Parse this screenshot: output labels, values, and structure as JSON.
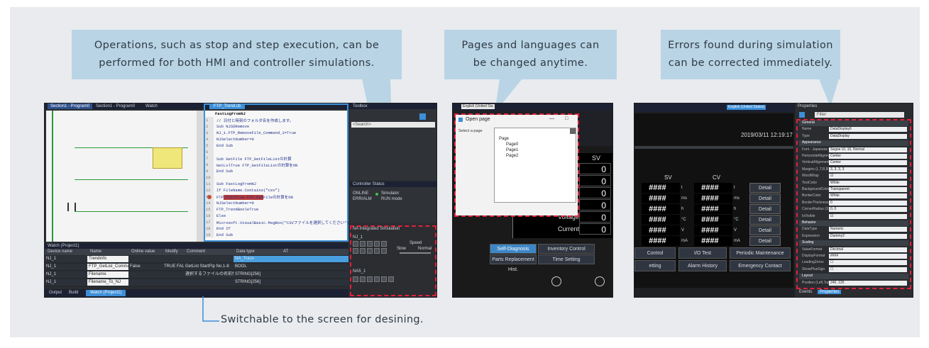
{
  "callouts": {
    "left": {
      "line1": "Operations, such as stop and step execution, can be",
      "line2": "performed for both HMI and controller simulations."
    },
    "middle": {
      "line1": "Pages and languages can",
      "line2": "be changed anytime."
    },
    "right": {
      "line1": "Errors found during simulation",
      "line2": "can be corrected immediately."
    }
  },
  "caption": "Switchable to the screen for desining.",
  "colors": {
    "callout_bg": "#b9d4e5",
    "highlight": "#e0213b",
    "switch_frame": "#3d8fd8"
  },
  "left_screen": {
    "tabs": [
      "Section1 - Program0",
      "Section1 - Program0",
      "Watch"
    ],
    "code_tab": "FTP_Trend.cb",
    "code_title": "FastLogFromNJ",
    "code_lines": [
      "// 日付と時刻のフォルダ名を作成します。",
      "Sub NJSDRemove",
      "  NJ_1.FTP_RemoveFile_Command_1=True",
      "  NJSelectNumber=0",
      "End Sub",
      "",
      "Sub GetFile         FTP_GetFileListの計算",
      "  GetLvlTrue        FTP_GetFileListの計算をON",
      "End Sub",
      "",
      "Sub FastLogFromNJ",
      "  If FileName.Contains(\"csv\")",
      "  FTP_PutsTrue      FTP_PutFileの計算をON",
      "  NJSelectNumber=0",
      "  FTP_TrendBooleTrue",
      "  Else",
      "  Microsoft.VisualBasic.MsgBox(\"CSVファイルを選択してください\")",
      "  End If",
      "End Sub"
    ],
    "toolbox_title": "Toolbox",
    "toolbox_search": "<Search>",
    "controller_status_title": "Controller Status",
    "controller_status_rows": [
      [
        "ONLINE",
        "Simulator"
      ],
      [
        "ERR/ALM",
        "RUN mode"
      ]
    ],
    "sim_panel_title": "NA Integrated Simulation",
    "sim_labels": {
      "nj": "NJ_1",
      "speed": "Speed",
      "slow": "Slow",
      "normal": "Normal",
      "na": "NA5_1"
    },
    "watch_title": "Watch (Project1)",
    "watch_headers": [
      "Device name",
      "Name",
      "Online value",
      "Modify",
      "Comment",
      "Data type",
      "AT"
    ],
    "watch_rows": [
      [
        "NJ_1",
        "Trendinfo",
        "",
        "",
        "",
        "NA_Trace",
        ""
      ],
      [
        "NJ_1",
        "FTP_GetList_Command_1",
        "False",
        "TRUE FALSE",
        "GetList StartFtp No.1-8",
        "BOOL",
        ""
      ],
      [
        "NJ_1",
        "Filename",
        "",
        "",
        "選択するファイルの名前情報",
        "STRING[256]",
        ""
      ],
      [
        "NJ_1",
        "Filename_To_NJ",
        "",
        "",
        "",
        "STRING[256]",
        ""
      ]
    ],
    "bottom_tabs": [
      "Output",
      "Build",
      "Watch (Project1)"
    ]
  },
  "middle_screen": {
    "language_dropdown": "English (United Sta",
    "dialog_title": "Open page",
    "minimize_glyph": "—",
    "maximize_glyph": "□",
    "select_label": "Select a page",
    "tree_root": "Page",
    "tree_items": [
      "Page0",
      "Page1",
      "Page2"
    ],
    "hmi_partial_header": "SV",
    "values": [
      "0",
      "0",
      "0",
      "0",
      "0",
      "0"
    ],
    "row_labels": [
      "Voltage",
      "Current"
    ],
    "buttons_row1": [
      "Self-Diagnosis",
      "Inventory Control"
    ],
    "buttons_row2": [
      "Parts Replacement Hist.",
      "Time Setting"
    ]
  },
  "right_screen": {
    "language_dropdown": "English (United States)",
    "timestamp": "2019/03/11 12:19:17",
    "col_headers": [
      "SV",
      "CV"
    ],
    "rows": [
      {
        "sv": "####",
        "unit_sv": "t",
        "cv": "####",
        "unit_cv": "t",
        "action": "Detail"
      },
      {
        "sv": "####",
        "unit_sv": "ms",
        "cv": "####",
        "unit_cv": "ms",
        "action": "Detail"
      },
      {
        "sv": "####",
        "unit_sv": "h",
        "cv": "####",
        "unit_cv": "h",
        "action": "Detail"
      },
      {
        "sv": "####",
        "unit_sv": "°C",
        "cv": "####",
        "unit_cv": "°C",
        "action": "Detail"
      },
      {
        "sv": "####",
        "unit_sv": "V",
        "cv": "####",
        "unit_cv": "V",
        "action": "Detail"
      },
      {
        "sv": "####",
        "unit_sv": "mA",
        "cv": "####",
        "unit_cv": "mA",
        "action": "Detail"
      }
    ],
    "buttons_row1": [
      "Control",
      "I/O Test",
      "Periodic Maintenance"
    ],
    "buttons_row2": [
      "etting",
      "Alarm History",
      "Emergency Contact"
    ],
    "properties_title": "Properties",
    "properties_filter": "Filter",
    "properties": [
      [
        "General",
        ""
      ],
      [
        "Name",
        "DataDisplay6"
      ],
      [
        "Type",
        "DataDisplay"
      ],
      [
        "Appearance",
        ""
      ],
      [
        "Font - Japanese (Japan)",
        "Segoe UI, 10, Normal"
      ],
      [
        "HorizontalAlignment",
        "Center"
      ],
      [
        "VerticalAlignment",
        "Center"
      ],
      [
        "Margins (L,T,R,B)",
        "3, 3, 3, 3"
      ],
      [
        "WordWrap",
        "☑"
      ],
      [
        "TextColor",
        "White"
      ],
      [
        "BackgroundColor",
        "Transparent"
      ],
      [
        "BorderColor",
        "White"
      ],
      [
        "BorderThickness",
        "0"
      ],
      [
        "CornerRadius (X,Y)",
        "0, 0"
      ],
      [
        "IsVisible",
        "☑"
      ],
      [
        "Behavior",
        ""
      ],
      [
        "DataType",
        "Numeric"
      ],
      [
        "Expression",
        "Dummy2"
      ],
      [
        "Scaling",
        ""
      ],
      [
        "ValueFormat",
        "Decimal"
      ],
      [
        "DisplayFormat",
        "####"
      ],
      [
        "LeadingZeros",
        "☐"
      ],
      [
        "ShowPlusSign",
        "☐"
      ],
      [
        "Layout",
        ""
      ],
      [
        "Position (Left,Top)",
        "240, 120"
      ]
    ],
    "properties_tabs": [
      "Events",
      "Properties"
    ]
  }
}
